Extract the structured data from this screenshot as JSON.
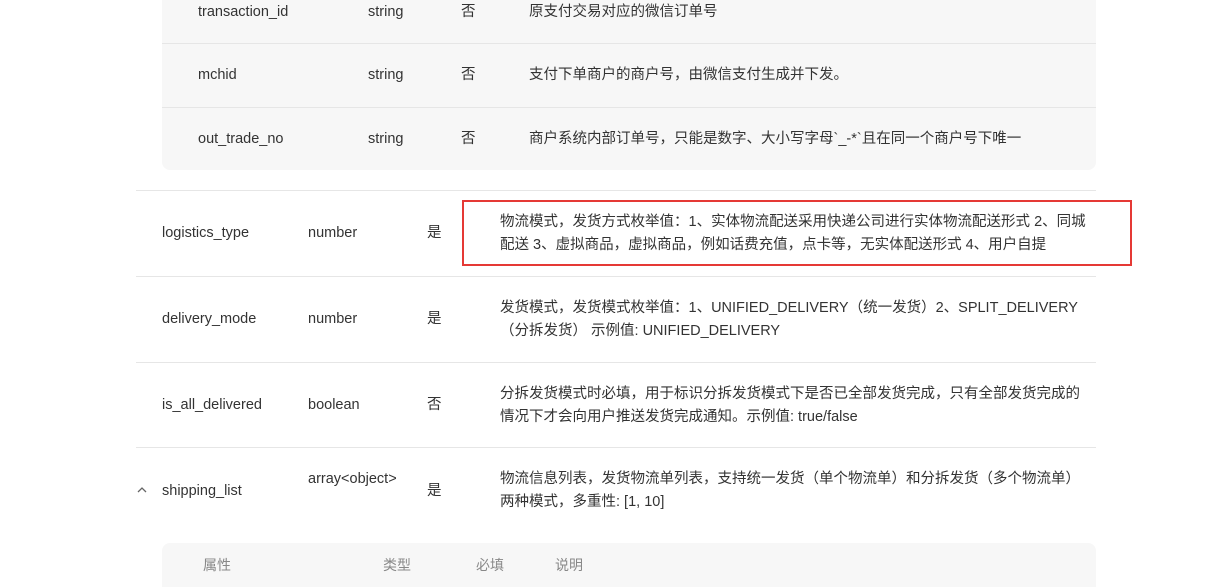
{
  "nested_rows": [
    {
      "name": "transaction_id",
      "type": "string",
      "required": "否",
      "desc": "原支付交易对应的微信订单号"
    },
    {
      "name": "mchid",
      "type": "string",
      "required": "否",
      "desc": "支付下单商户的商户号，由微信支付生成并下发。"
    },
    {
      "name": "out_trade_no",
      "type": "string",
      "required": "否",
      "desc": "商户系统内部订单号，只能是数字、大小写字母`_-*`且在同一个商户号下唯一"
    }
  ],
  "rows": [
    {
      "name": "logistics_type",
      "type": "number",
      "required": "是",
      "desc": "物流模式，发货方式枚举值：1、实体物流配送采用快递公司进行实体物流配送形式 2、同城配送 3、虚拟商品，虚拟商品，例如话费充值，点卡等，无实体配送形式 4、用户自提"
    },
    {
      "name": "delivery_mode",
      "type": "number",
      "required": "是",
      "desc": "发货模式，发货模式枚举值：1、UNIFIED_DELIVERY（统一发货）2、SPLIT_DELIVERY（分拆发货） 示例值: UNIFIED_DELIVERY"
    },
    {
      "name": "is_all_delivered",
      "type": "boolean",
      "required": "否",
      "desc": "分拆发货模式时必填，用于标识分拆发货模式下是否已全部发货完成，只有全部发货完成的情况下才会向用户推送发货完成通知。示例值: true/false"
    },
    {
      "name": "shipping_list",
      "type": "array<object>",
      "required": "是",
      "desc": "物流信息列表，发货物流单列表，支持统一发货（单个物流单）和分拆发货（多个物流单）两种模式，多重性: [1, 10]"
    }
  ],
  "sub_header": {
    "name": "属性",
    "type": "类型",
    "required": "必填",
    "desc": "说明"
  },
  "colors": {
    "highlight": "#e53935",
    "nested_bg": "#f7f7f7",
    "divider": "#e6e6e6"
  },
  "icons": {
    "expand": "chevron-up-icon"
  }
}
